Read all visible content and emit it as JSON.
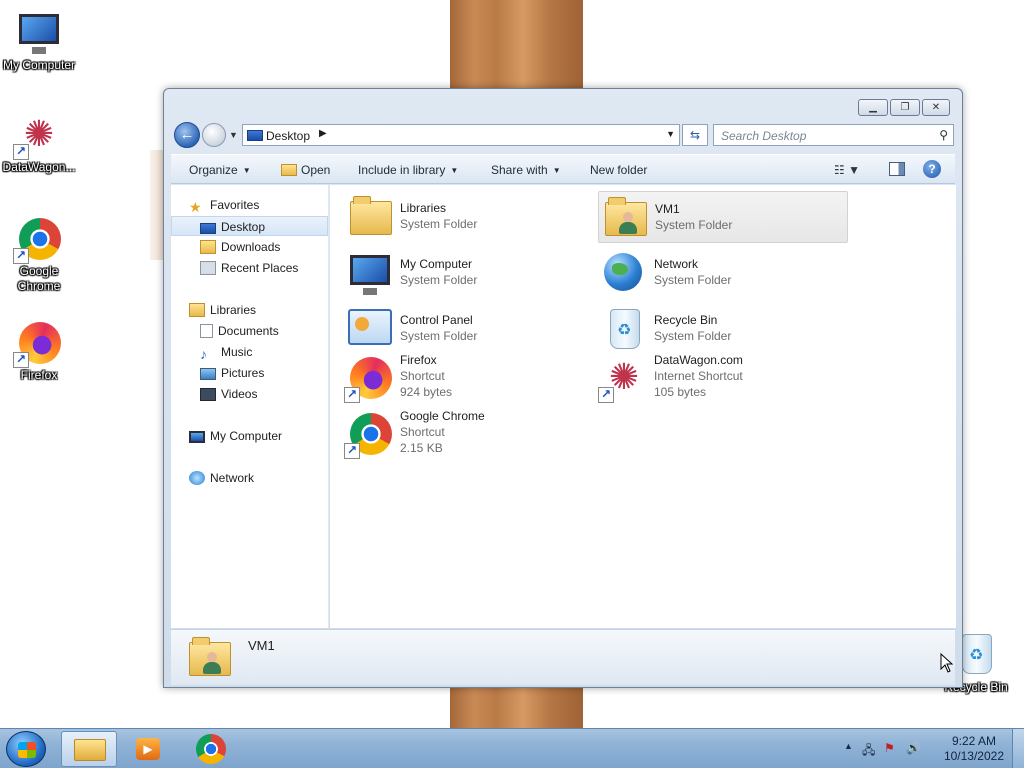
{
  "desktop": {
    "icons": [
      {
        "label": "My Computer",
        "icon": "computer-icon"
      },
      {
        "label": "DataWagon...",
        "icon": "datawagon-icon"
      },
      {
        "label": "Google Chrome",
        "icon": "chrome-icon"
      },
      {
        "label": "Firefox",
        "icon": "firefox-icon"
      },
      {
        "label": "Recycle Bin",
        "icon": "recycle-bin-icon"
      }
    ]
  },
  "window": {
    "address": {
      "location": "Desktop"
    },
    "search": {
      "placeholder": "Search Desktop"
    },
    "toolbar": {
      "organize": "Organize",
      "open": "Open",
      "include_in_library": "Include in library",
      "share_with": "Share with",
      "new_folder": "New folder"
    },
    "nav": {
      "favorites": "Favorites",
      "desktop": "Desktop",
      "downloads": "Downloads",
      "recent_places": "Recent Places",
      "libraries": "Libraries",
      "documents": "Documents",
      "music": "Music",
      "pictures": "Pictures",
      "videos": "Videos",
      "my_computer": "My Computer",
      "network": "Network"
    },
    "items": {
      "libraries": {
        "name": "Libraries",
        "type": "System Folder"
      },
      "vm1": {
        "name": "VM1",
        "type": "System Folder"
      },
      "my_computer": {
        "name": "My Computer",
        "type": "System Folder"
      },
      "network": {
        "name": "Network",
        "type": "System Folder"
      },
      "control_panel": {
        "name": "Control Panel",
        "type": "System Folder"
      },
      "recycle_bin": {
        "name": "Recycle Bin",
        "type": "System Folder"
      },
      "firefox": {
        "name": "Firefox",
        "type": "Shortcut",
        "size": "924 bytes"
      },
      "datawagon": {
        "name": "DataWagon.com",
        "type": "Internet Shortcut",
        "size": "105 bytes"
      },
      "chrome": {
        "name": "Google Chrome",
        "type": "Shortcut",
        "size": "2.15 KB"
      }
    },
    "details": {
      "name": "VM1"
    }
  },
  "taskbar": {
    "clock": {
      "time": "9:22 AM",
      "date": "10/13/2022"
    }
  }
}
